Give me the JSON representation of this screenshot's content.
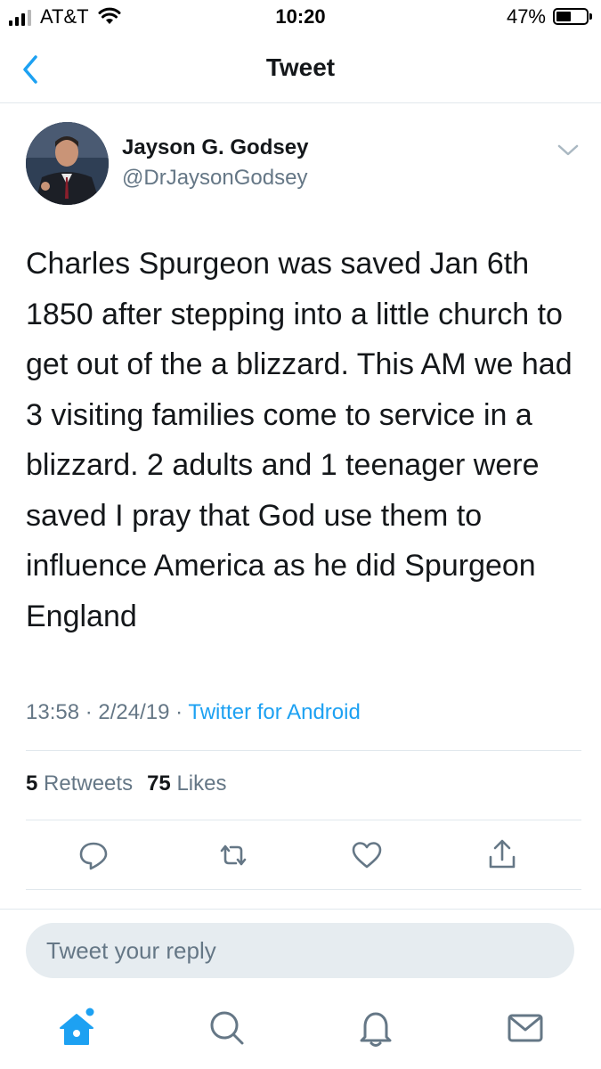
{
  "status_bar": {
    "carrier": "AT&T",
    "time": "10:20",
    "battery": "47%"
  },
  "nav": {
    "title": "Tweet"
  },
  "tweet": {
    "author_name": "Jayson G. Godsey",
    "author_handle": "@DrJaysonGodsey",
    "text": "Charles Spurgeon was saved Jan 6th 1850 after stepping into a little church to get out of the a blizzard. This AM we had 3 visiting families come to service in a blizzard. 2 adults and 1 teenager were saved I pray that God use them to influence America as he did Spurgeon England",
    "time": "13:58",
    "date": "2/24/19",
    "source": "Twitter for Android",
    "separator": "·",
    "retweets_count": "5",
    "retweets_label": "Retweets",
    "likes_count": "75",
    "likes_label": "Likes"
  },
  "actions": [
    "reply-icon",
    "retweet-icon",
    "like-icon",
    "share-icon"
  ],
  "reply": {
    "placeholder": "Tweet your reply"
  },
  "tab_bar": [
    "home-icon",
    "search-icon",
    "notifications-icon",
    "messages-icon"
  ],
  "colors": {
    "accent": "#1da1f2",
    "secondary_text": "#657786",
    "divider": "#e1e8ed",
    "reply_box": "#e6ecf0"
  }
}
